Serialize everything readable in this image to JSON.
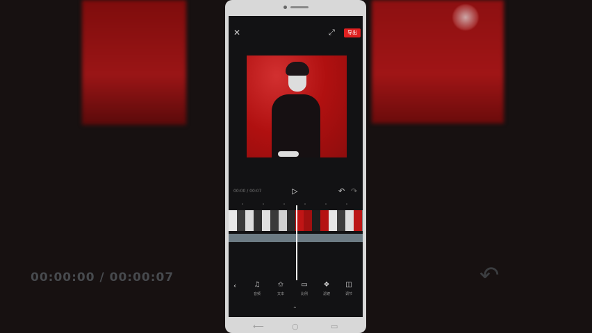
{
  "background": {
    "blurred_text": "00:00:00 / 00:00:07"
  },
  "editor": {
    "export_label": "导出",
    "time_display": "00:00 / 00:07",
    "tools": [
      {
        "icon": "audio-icon",
        "label": "音频"
      },
      {
        "icon": "text-icon",
        "label": "文本"
      },
      {
        "icon": "canvas-icon",
        "label": "比例"
      },
      {
        "icon": "filter-icon",
        "label": "滤镜"
      },
      {
        "icon": "adjust-icon",
        "label": "调节"
      }
    ]
  },
  "colors": {
    "accent": "#e02020",
    "screen_bg": "#121214",
    "preview_red": "#b01010"
  }
}
